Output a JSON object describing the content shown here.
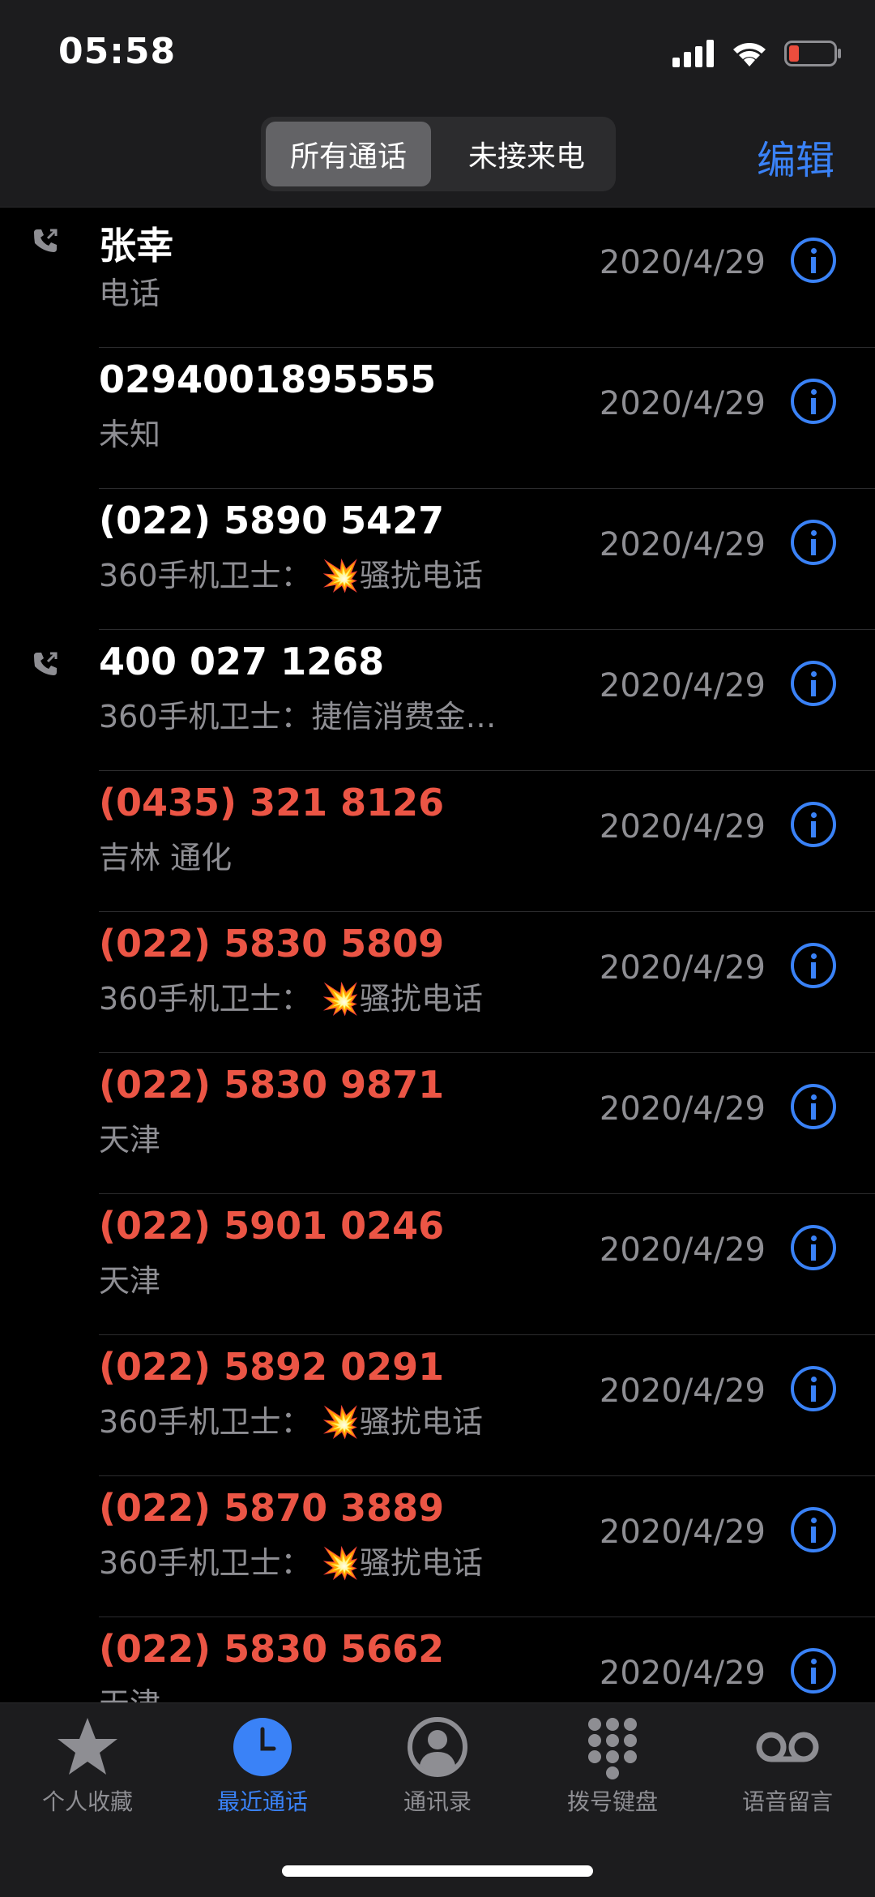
{
  "status_bar": {
    "time": "05:58",
    "icons": [
      "cellular-signal-icon",
      "wifi-icon",
      "battery-low-icon"
    ]
  },
  "header": {
    "segments": {
      "all_calls": "所有通话",
      "missed_calls": "未接来电",
      "selected": "所有通话"
    },
    "edit_label": "编辑"
  },
  "colors": {
    "accent": "#3a82f7",
    "missed": "#eb5545",
    "secondary_text": "#8e8e93",
    "background": "#000000",
    "bar_background": "#1c1c1e"
  },
  "calls": [
    {
      "name": "张幸",
      "subtitle": "电话",
      "spam": false,
      "date": "2020/4/29",
      "missed": false,
      "outgoing": true
    },
    {
      "name": "0294001895555",
      "subtitle": "未知",
      "spam": false,
      "date": "2020/4/29",
      "missed": false,
      "outgoing": false
    },
    {
      "name": "(022) 5890 5427",
      "subtitle": "360手机卫士：",
      "spam": true,
      "spam_text": "骚扰电话",
      "date": "2020/4/29",
      "missed": false,
      "outgoing": false
    },
    {
      "name": "400 027 1268",
      "subtitle": "360手机卫士：捷信消费金…",
      "spam": false,
      "date": "2020/4/29",
      "missed": false,
      "outgoing": true
    },
    {
      "name": "(0435) 321 8126",
      "subtitle": "吉林 通化",
      "spam": false,
      "date": "2020/4/29",
      "missed": true,
      "outgoing": false
    },
    {
      "name": "(022) 5830 5809",
      "subtitle": "360手机卫士：",
      "spam": true,
      "spam_text": "骚扰电话",
      "date": "2020/4/29",
      "missed": true,
      "outgoing": false
    },
    {
      "name": "(022) 5830 9871",
      "subtitle": "天津",
      "spam": false,
      "date": "2020/4/29",
      "missed": true,
      "outgoing": false
    },
    {
      "name": "(022) 5901 0246",
      "subtitle": "天津",
      "spam": false,
      "date": "2020/4/29",
      "missed": true,
      "outgoing": false
    },
    {
      "name": "(022) 5892 0291",
      "subtitle": "360手机卫士：",
      "spam": true,
      "spam_text": "骚扰电话",
      "date": "2020/4/29",
      "missed": true,
      "outgoing": false
    },
    {
      "name": "(022) 5870 3889",
      "subtitle": "360手机卫士：",
      "spam": true,
      "spam_text": "骚扰电话",
      "date": "2020/4/29",
      "missed": true,
      "outgoing": false
    },
    {
      "name": "(022) 5830 5662",
      "subtitle": "天津",
      "spam": false,
      "date": "2020/4/29",
      "missed": true,
      "outgoing": false
    }
  ],
  "tabbar": {
    "active": "recents",
    "items": [
      {
        "id": "favorites",
        "label": "个人收藏",
        "icon": "star-icon"
      },
      {
        "id": "recents",
        "label": "最近通话",
        "icon": "clock-icon"
      },
      {
        "id": "contacts",
        "label": "通讯录",
        "icon": "person-circle-icon"
      },
      {
        "id": "keypad",
        "label": "拨号键盘",
        "icon": "keypad-icon"
      },
      {
        "id": "voicemail",
        "label": "语音留言",
        "icon": "voicemail-icon"
      }
    ]
  }
}
